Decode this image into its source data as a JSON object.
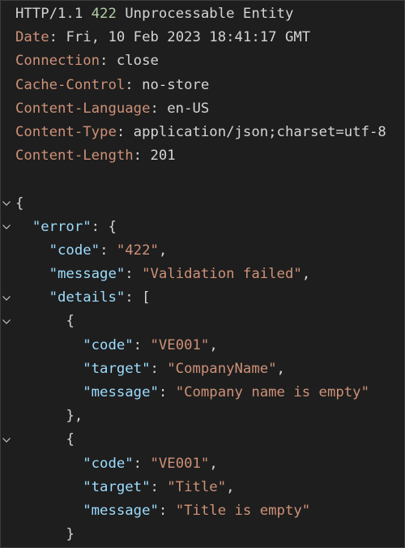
{
  "status": {
    "protocol": "HTTP/1.1",
    "code": "422",
    "reason": "Unprocessable Entity"
  },
  "headers": [
    {
      "name": "Date",
      "value": "Fri, 10 Feb 2023 18:41:17 GMT"
    },
    {
      "name": "Connection",
      "value": "close"
    },
    {
      "name": "Cache-Control",
      "value": "no-store"
    },
    {
      "name": "Content-Language",
      "value": "en-US"
    },
    {
      "name": "Content-Type",
      "value": "application/json;charset=utf-8"
    },
    {
      "name": "Content-Length",
      "value": "201"
    }
  ],
  "body": {
    "error_key": "\"error\"",
    "code_key": "\"code\"",
    "code_value": "\"422\"",
    "message_key": "\"message\"",
    "message_value": "\"Validation failed\"",
    "details_key": "\"details\"",
    "details": [
      {
        "code_key": "\"code\"",
        "code_value": "\"VE001\"",
        "target_key": "\"target\"",
        "target_value": "\"CompanyName\"",
        "message_key": "\"message\"",
        "message_value": "\"Company name is empty\""
      },
      {
        "code_key": "\"code\"",
        "code_value": "\"VE001\"",
        "target_key": "\"target\"",
        "target_value": "\"Title\"",
        "message_key": "\"message\"",
        "message_value": "\"Title is empty\""
      }
    ]
  },
  "punct": {
    "colon": ":",
    "colon_space": ": ",
    "comma": ",",
    "open_brace": "{",
    "close_brace": "}",
    "close_brace_comma": "},",
    "open_bracket": "[",
    "space": " "
  },
  "icons": {
    "fold": "chevron-down-icon"
  },
  "colors": {
    "background": "#1e1e1e",
    "text": "#d4d4d4",
    "header_name": "#ce9178",
    "status_code": "#b5cea8",
    "json_key": "#9cdcfe",
    "json_string": "#ce9178"
  }
}
